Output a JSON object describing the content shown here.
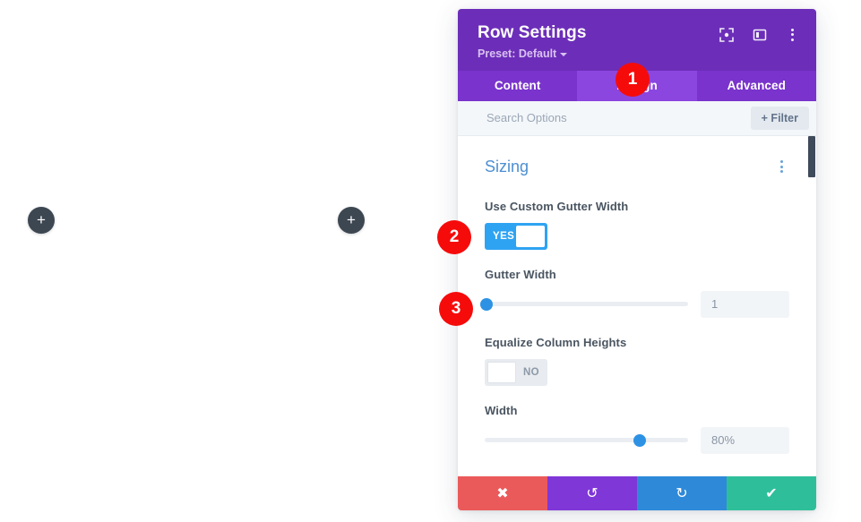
{
  "canvas": {
    "add_button_left": "+",
    "add_button_right": "+"
  },
  "panel": {
    "title": "Row Settings",
    "preset_label": "Preset: Default",
    "header_icons": [
      {
        "name": "focus-target-icon"
      },
      {
        "name": "layout-panel-icon"
      },
      {
        "name": "more-options-icon"
      }
    ],
    "tabs": [
      {
        "label": "Content",
        "active": false
      },
      {
        "label": "Design",
        "active": true
      },
      {
        "label": "Advanced",
        "active": false
      }
    ],
    "search": {
      "placeholder": "Search Options",
      "value": ""
    },
    "filter_button": "+ Filter",
    "section": {
      "title": "Sizing"
    },
    "fields": [
      {
        "label": "Use Custom Gutter Width",
        "type": "toggle",
        "state": "YES"
      },
      {
        "label": "Gutter Width",
        "type": "slider",
        "value": "1",
        "handle_percent": 1
      },
      {
        "label": "Equalize Column Heights",
        "type": "toggle",
        "state": "NO"
      },
      {
        "label": "Width",
        "type": "slider",
        "value": "80%",
        "handle_percent": 76
      }
    ],
    "footer": [
      {
        "name": "discard-button",
        "glyph": "✖"
      },
      {
        "name": "undo-button",
        "glyph": "↺"
      },
      {
        "name": "redo-button",
        "glyph": "↻"
      },
      {
        "name": "save-button",
        "glyph": "✔"
      }
    ]
  },
  "callouts": [
    {
      "number": "1"
    },
    {
      "number": "2"
    },
    {
      "number": "3"
    }
  ],
  "colors": {
    "header_purple": "#6c2eb9",
    "tab_bar_purple": "#7a33cc",
    "tab_active_purple": "#8c46e0",
    "accent_blue": "#2ea3f2",
    "section_blue": "#4d8fd1",
    "badge_red": "#f60b0b",
    "discard_red": "#eb5a5a",
    "undo_purple": "#7f37d8",
    "redo_blue": "#2e8ad8",
    "save_green": "#2ebf9a"
  }
}
